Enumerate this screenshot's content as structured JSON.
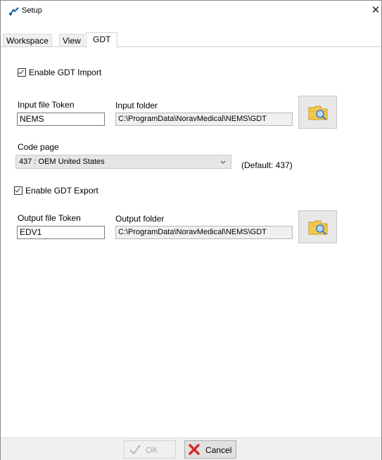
{
  "window": {
    "title": "Setup",
    "close_glyph": "✕"
  },
  "tabs": [
    {
      "label": "Workspace",
      "active": false
    },
    {
      "label": "View",
      "active": false
    },
    {
      "label": "GDT",
      "active": true
    }
  ],
  "gdt_import": {
    "enable_label": "Enable GDT Import",
    "checked": true,
    "token_label": "Input file Token",
    "token_value": "NEMS",
    "folder_label": "Input folder",
    "folder_value": "C:\\ProgramData\\NoravMedical\\NEMS\\GDT",
    "browse_icon": "folder-search-icon"
  },
  "code_page": {
    "label": "Code page",
    "selected": "437 : OEM United States",
    "default_text": "(Default: 437)"
  },
  "gdt_export": {
    "enable_label": "Enable GDT Export",
    "checked": true,
    "token_label": "Output file Token",
    "token_value": "EDV1",
    "folder_label": "Output folder",
    "folder_value": "C:\\ProgramData\\NoravMedical\\NEMS\\GDT",
    "browse_icon": "folder-search-icon"
  },
  "footer": {
    "ok_label": "OK",
    "ok_enabled": false,
    "cancel_label": "Cancel"
  },
  "colors": {
    "cancel_icon": "#d62a2a",
    "folder": "#f2c94c",
    "magnifier": "#3a7bd5"
  }
}
